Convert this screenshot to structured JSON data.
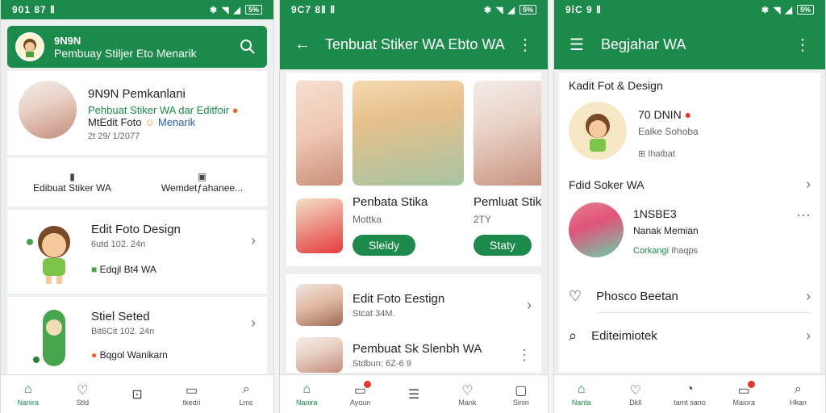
{
  "colors": {
    "brand": "#1c8a4a",
    "accent_red": "#e23b2e",
    "link_blue": "#2a5aa8"
  },
  "panel1": {
    "status": {
      "time": "901 87 Ⅱ",
      "battery": "5%"
    },
    "header": {
      "line1": "9N9N",
      "line2": "Pembuay Stiljer Eto Menarik"
    },
    "profile": {
      "name": "9N9N Pemkanlani",
      "line2": "Pehbuat Stiker WA dar Editfoir",
      "line3a": "MtEdit Foto",
      "line3b": "Menarik",
      "date": "2t 29/ 1/2077"
    },
    "tabs": {
      "left": "Edibuat Stiker WA",
      "right": "Wemdetƒahanee..."
    },
    "items": [
      {
        "title": "Edit Foto Design",
        "meta": "6utd 102. 24n",
        "foot": "Edqjl Bt4 WA"
      },
      {
        "title": "Stiel Seted",
        "meta": "Bit6Cit 102. 24n",
        "foot": "Bqgol Wanikarn"
      }
    ],
    "nav": [
      "Nanira",
      "Stld",
      "",
      "tkedri",
      "Lmc"
    ]
  },
  "panel2": {
    "status": {
      "time": "9C7 8Ⅱ Ⅱ",
      "battery": "5%"
    },
    "appbar_title": "Tenbuat Stiker WA Ebto WA",
    "cards": [
      {
        "title": "Penbata Stika",
        "sub": "Mottka",
        "button": "Sleidy"
      },
      {
        "title": "Pemluat Stiker W",
        "sub": "2TY",
        "button": "Staty"
      }
    ],
    "list": [
      {
        "title": "Edit Foto Eestign",
        "meta": "Stcat 34M."
      },
      {
        "title": "Pembuat Sk Slenbh WA",
        "meta": "Stdbun: 6Z-6 9"
      }
    ],
    "nav": [
      "Nanira",
      "Ayoun",
      "",
      "Mank",
      "Sinin"
    ]
  },
  "panel3": {
    "status": {
      "time": "9ⅰC 9 Ⅱ",
      "battery": "5%"
    },
    "appbar_title": "Begjahar WA",
    "section1": "Kadit Fot & Design",
    "profile1": {
      "name": "70 DNIN",
      "sub": "Ealke Sohoba",
      "meta": "Ihatbat"
    },
    "section2": "Fdid Soker WA",
    "profile2": {
      "name": "1NSBE3",
      "sub": "Nanak Memian",
      "meta": "Corkangi",
      "meta2": "Ihaqps"
    },
    "menu": [
      {
        "label": "Phosco Beetan"
      },
      {
        "label": "Editeimiotek"
      }
    ],
    "nav": [
      "Nanla",
      "Dkll",
      "tamt sano",
      "Maiora",
      "Hkan"
    ]
  }
}
